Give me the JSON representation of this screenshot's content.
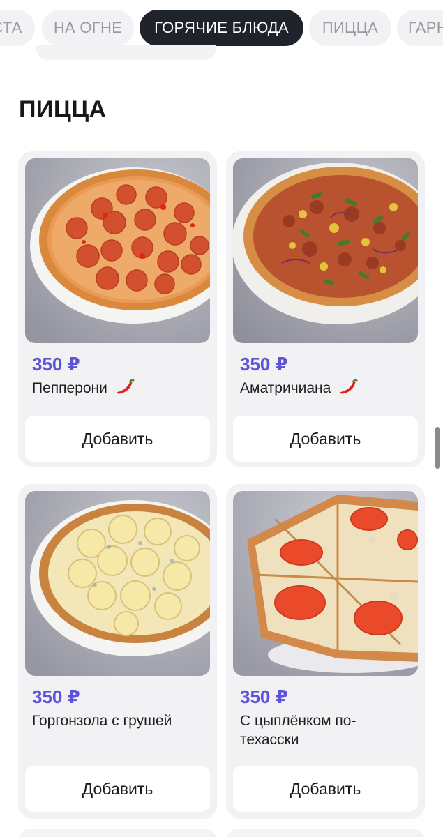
{
  "category_tabs": [
    {
      "label": "СТА",
      "active": false
    },
    {
      "label": "НА ОГНЕ",
      "active": false
    },
    {
      "label": "ГОРЯЧИЕ БЛЮДА",
      "active": true
    },
    {
      "label": "ПИЦЦА",
      "active": false
    },
    {
      "label": "ГАРН",
      "active": false
    }
  ],
  "section": {
    "title": "ПИЦЦА"
  },
  "products": [
    {
      "price": "350 ₽",
      "name": "Пепперони",
      "spicy": true,
      "button": "Добавить",
      "image": "pepperoni-pizza"
    },
    {
      "price": "350 ₽",
      "name": "Аматричиана",
      "spicy": true,
      "button": "Добавить",
      "image": "amatriciana-pizza"
    },
    {
      "price": "350 ₽",
      "name": "Горгонзола с грушей",
      "spicy": false,
      "button": "Добавить",
      "image": "gorgonzola-pear-pizza"
    },
    {
      "price": "350 ₽",
      "name": "С цыплёнком по-техасски",
      "spicy": false,
      "button": "Добавить",
      "image": "texas-chicken-pizza"
    }
  ],
  "colors": {
    "accent_price": "#5b54d6",
    "active_tab": "#1f232b",
    "card_bg": "#f2f2f4"
  }
}
